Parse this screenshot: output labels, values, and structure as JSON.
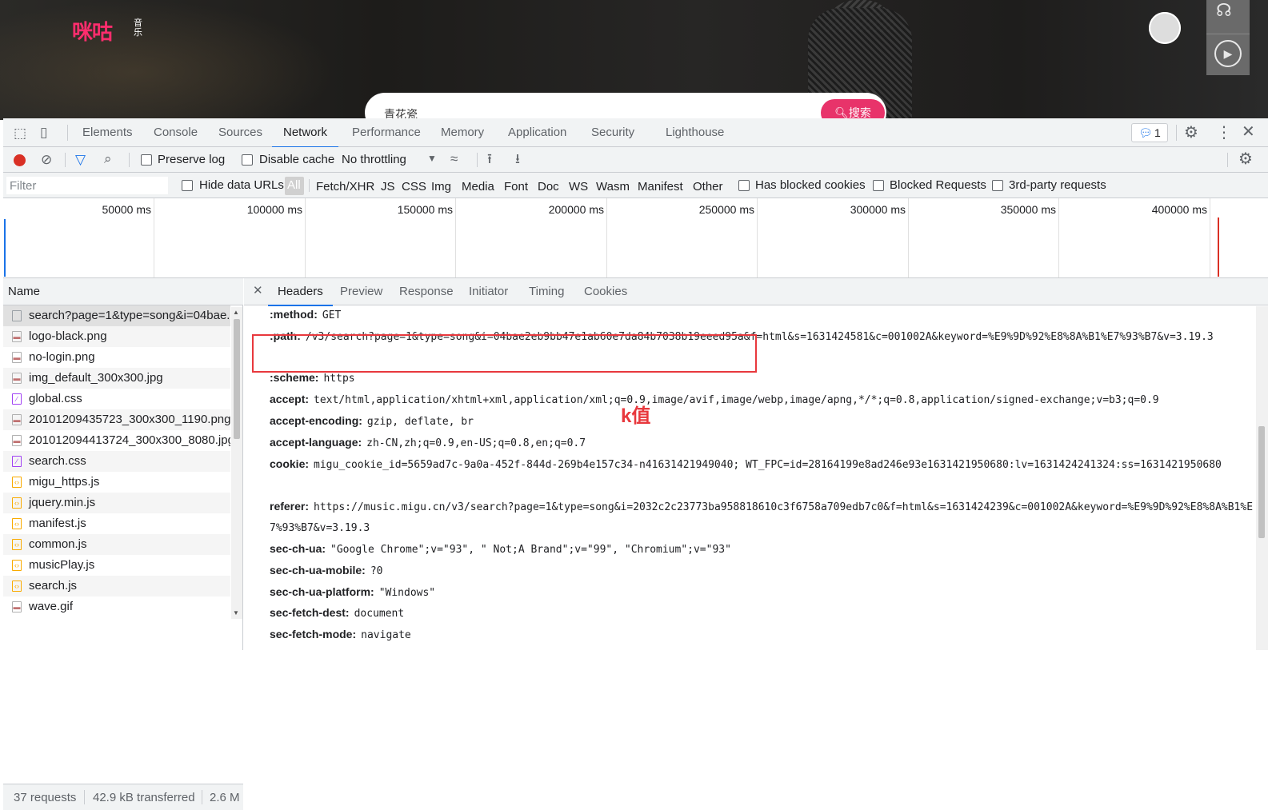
{
  "site": {
    "logo": "咪咕",
    "logo_sub": "音乐",
    "search_query": "青花瓷",
    "search_button": "搜索"
  },
  "devtools": {
    "tabs": [
      "Elements",
      "Console",
      "Sources",
      "Network",
      "Performance",
      "Memory",
      "Application",
      "Security",
      "Lighthouse"
    ],
    "active_tab": "Network",
    "issues_count": "1",
    "toolbar": {
      "preserve_log": "Preserve log",
      "disable_cache": "Disable cache",
      "throttling": "No throttling"
    },
    "filterbar": {
      "filter_placeholder": "Filter",
      "hide_data_urls": "Hide data URLs",
      "types": [
        "All",
        "Fetch/XHR",
        "JS",
        "CSS",
        "Img",
        "Media",
        "Font",
        "Doc",
        "WS",
        "Wasm",
        "Manifest",
        "Other"
      ],
      "has_blocked_cookies": "Has blocked cookies",
      "blocked_requests": "Blocked Requests",
      "third_party": "3rd-party requests"
    },
    "overview_ticks": [
      "50000 ms",
      "100000 ms",
      "150000 ms",
      "200000 ms",
      "250000 ms",
      "300000 ms",
      "350000 ms",
      "400000 ms"
    ],
    "name_header": "Name",
    "requests": [
      {
        "name": "search?page=1&type=song&i=04bae...",
        "kind": "doc"
      },
      {
        "name": "logo-black.png",
        "kind": "img"
      },
      {
        "name": "no-login.png",
        "kind": "img"
      },
      {
        "name": "img_default_300x300.jpg",
        "kind": "img"
      },
      {
        "name": "global.css",
        "kind": "css"
      },
      {
        "name": "20101209435723_300x300_1190.png",
        "kind": "img"
      },
      {
        "name": "201012094413724_300x300_8080.jpg",
        "kind": "img"
      },
      {
        "name": "search.css",
        "kind": "css"
      },
      {
        "name": "migu_https.js",
        "kind": "js"
      },
      {
        "name": "jquery.min.js",
        "kind": "js"
      },
      {
        "name": "manifest.js",
        "kind": "js"
      },
      {
        "name": "common.js",
        "kind": "js"
      },
      {
        "name": "musicPlay.js",
        "kind": "js"
      },
      {
        "name": "search.js",
        "kind": "js"
      },
      {
        "name": "wave.gif",
        "kind": "img"
      }
    ],
    "status": {
      "requests": "37 requests",
      "transferred": "42.9 kB transferred",
      "resources": "2.6 M"
    },
    "detail_tabs": [
      "Headers",
      "Preview",
      "Response",
      "Initiator",
      "Timing",
      "Cookies"
    ],
    "active_detail_tab": "Headers",
    "headers": [
      {
        "key": ":method:",
        "value": "GET"
      },
      {
        "key": ":path:",
        "value": "/v3/search?page=1&type=song&i=04bae2eb9bb47e1ab60e7da84b7038b19eeed95a&f=html&s=1631424581&c=001002A&keyword=%E9%9D%92%E8%8A%B1%E7%93%B7&v=3.19.3"
      },
      {
        "key": ":scheme:",
        "value": "https"
      },
      {
        "key": "accept:",
        "value": "text/html,application/xhtml+xml,application/xml;q=0.9,image/avif,image/webp,image/apng,*/*;q=0.8,application/signed-exchange;v=b3;q=0.9"
      },
      {
        "key": "accept-encoding:",
        "value": "gzip, deflate, br"
      },
      {
        "key": "accept-language:",
        "value": "zh-CN,zh;q=0.9,en-US;q=0.8,en;q=0.7"
      },
      {
        "key": "cookie:",
        "value": "migu_cookie_id=5659ad7c-9a0a-452f-844d-269b4e157c34-n41631421949040; WT_FPC=id=28164199e8ad246e93e1631421950680:lv=1631424241324:ss=1631421950680"
      },
      {
        "key": "referer:",
        "value": "https://music.migu.cn/v3/search?page=1&type=song&i=2032c2c23773ba958818610c3f6758a709edb7c0&f=html&s=1631424239&c=001002A&keyword=%E9%9D%92%E8%8A%B1%E7%93%B7&v=3.19.3"
      },
      {
        "key": "sec-ch-ua:",
        "value": "\"Google Chrome\";v=\"93\", \" Not;A Brand\";v=\"99\", \"Chromium\";v=\"93\""
      },
      {
        "key": "sec-ch-ua-mobile:",
        "value": "?0"
      },
      {
        "key": "sec-ch-ua-platform:",
        "value": "\"Windows\""
      },
      {
        "key": "sec-fetch-dest:",
        "value": "document"
      },
      {
        "key": "sec-fetch-mode:",
        "value": "navigate"
      }
    ],
    "annotation": "k值",
    "colors": {
      "accent": "#1a73e8",
      "record": "#d93025",
      "annotation": "#e8383d",
      "brand": "#ff2d6d"
    }
  }
}
